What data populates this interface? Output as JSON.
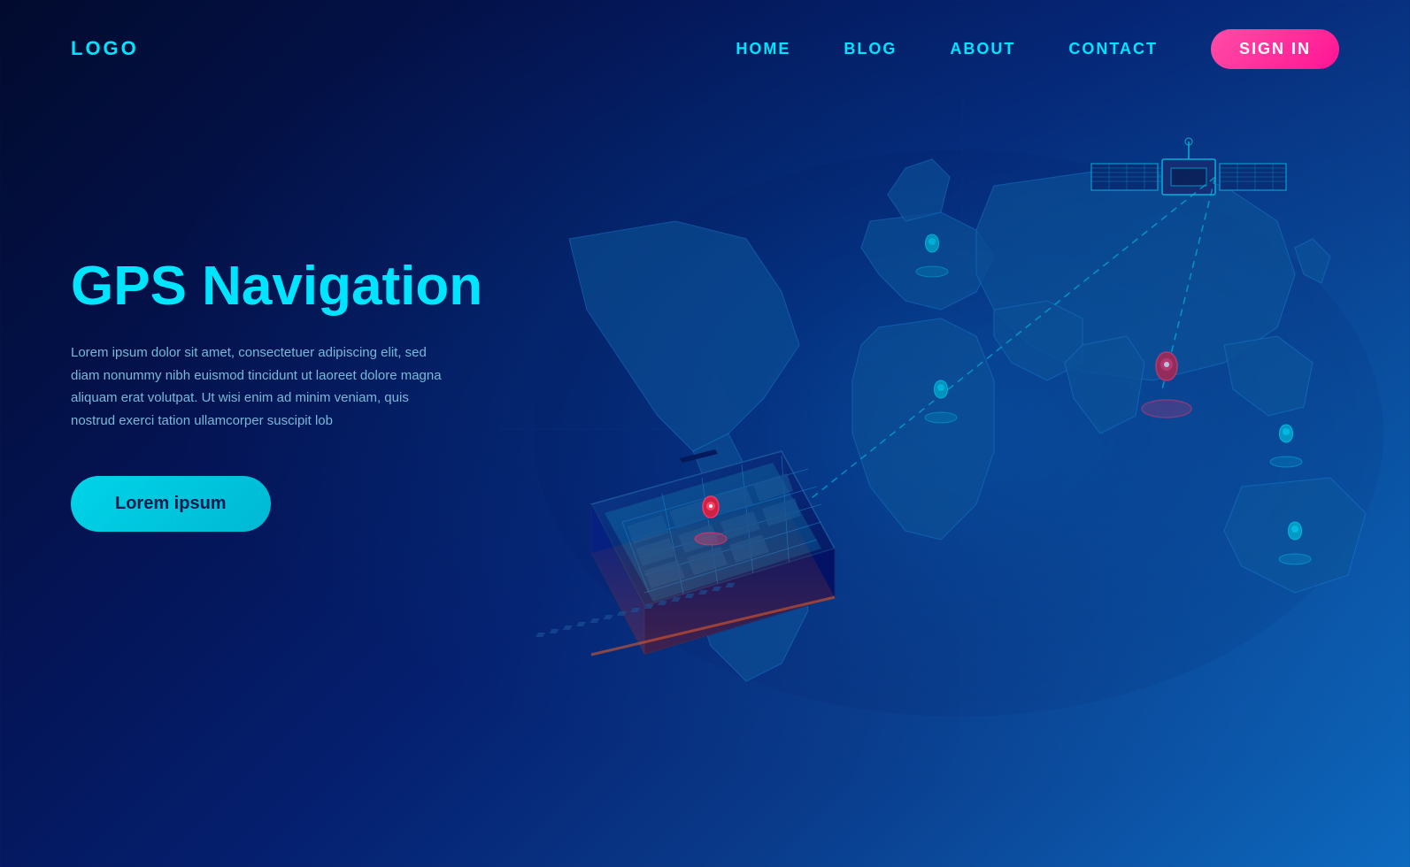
{
  "nav": {
    "logo": "LOGO",
    "links": [
      {
        "label": "HOME",
        "id": "home"
      },
      {
        "label": "BLOG",
        "id": "blog"
      },
      {
        "label": "ABOUT",
        "id": "about"
      },
      {
        "label": "CONTACT",
        "id": "contact"
      }
    ],
    "signin_label": "SIGN IN"
  },
  "hero": {
    "title": "GPS Navigation",
    "description": "Lorem ipsum dolor sit amet, consectetuer adipiscing elit, sed diam nonummy nibh euismod tincidunt ut laoreet dolore magna aliquam erat volutpat. Ut wisi enim ad minim veniam, quis nostrud exerci tation ullamcorper suscipit lob",
    "cta_label": "Lorem ipsum"
  },
  "colors": {
    "accent_cyan": "#00e5ff",
    "accent_pink": "#ff1493",
    "accent_red": "#ff3366",
    "nav_bg": "transparent",
    "body_bg_start": "#020b2e",
    "body_bg_end": "#0d6abf"
  }
}
